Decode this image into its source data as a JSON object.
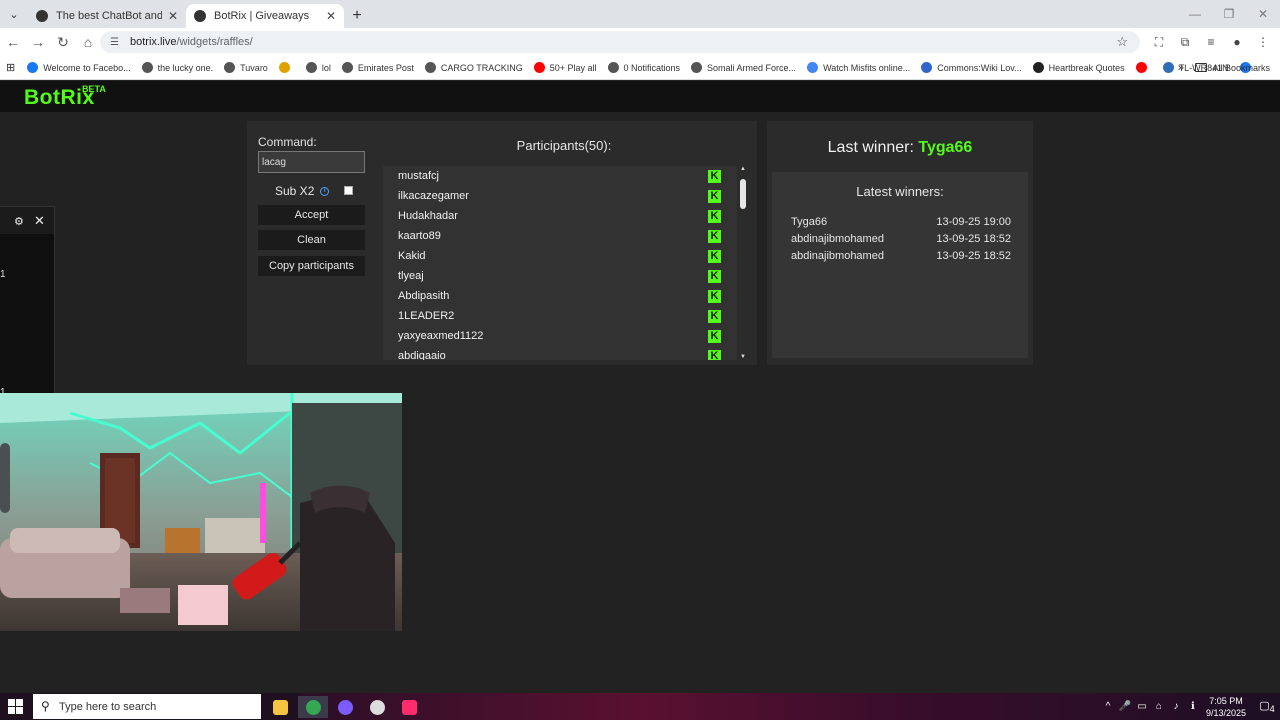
{
  "browser": {
    "tabs": [
      {
        "title": "The best ChatBot and Widgets",
        "close": "✕",
        "active": false
      },
      {
        "title": "BotRix | Giveaways",
        "close": "✕",
        "active": true
      }
    ],
    "new_tab": "+",
    "url_host": "botrix.live",
    "url_path": "/widgets/raffles/",
    "bookmarks": [
      {
        "label": "Welcome to Facebo...",
        "color": "#1877f2"
      },
      {
        "label": "the lucky one.",
        "color": "#555555"
      },
      {
        "label": "Tuvaro",
        "color": "#555555"
      },
      {
        "label": "",
        "color": "#e0a000"
      },
      {
        "label": "lol",
        "color": "#555555"
      },
      {
        "label": "Emirates Post",
        "color": "#555555"
      },
      {
        "label": "CARGO TRACKING",
        "color": "#555555"
      },
      {
        "label": "50+ Play all",
        "color": "#ff0000"
      },
      {
        "label": "0 Notifications",
        "color": "#555555"
      },
      {
        "label": "Somali Armed Force...",
        "color": "#555555"
      },
      {
        "label": "Watch Misfits online...",
        "color": "#4285f4"
      },
      {
        "label": "Commons:Wiki Lov...",
        "color": "#3366cc"
      },
      {
        "label": "Heartbreak Quotes",
        "color": "#222222"
      },
      {
        "label": "",
        "color": "#ff0000"
      },
      {
        "label": "TL-WR841N",
        "color": "#2f6fb5"
      },
      {
        "label": "",
        "color": "#1877f2"
      }
    ],
    "bookmarks_more": "»",
    "all_bookmarks": "All Bookmarks"
  },
  "site": {
    "logo": "BotRix",
    "beta": "BETA"
  },
  "raffle": {
    "command_label": "Command:",
    "command_value": "lacag",
    "sub_x2_label": "Sub X2",
    "info": "i",
    "accept": "Accept",
    "clean": "Clean",
    "copy": "Copy participants",
    "participants_title": "Participants(50):",
    "participants": [
      "mustafcj",
      "ilkacazegamer",
      "Hudakhadar",
      "kaarto89",
      "Kakid",
      "tlyeaj",
      "Abdipasith",
      "1LEADER2",
      "yaxyeaxmed1122",
      "abdiqaaio"
    ],
    "kick_glyph": "K",
    "scroll_up": "▲",
    "scroll_down": "▼"
  },
  "winners": {
    "last_winner_label": "Last winner:",
    "last_winner_name": "Tyga66",
    "latest_title": "Latest winners:",
    "list": [
      {
        "name": "Tyga66",
        "date": "13-09-25 19:00"
      },
      {
        "name": "abdinajibmohamed",
        "date": "13-09-25 18:52"
      },
      {
        "name": "abdinajibmohamed",
        "date": "13-09-25 18:52"
      }
    ]
  },
  "dock": {
    "mark1": "1",
    "mark2": "1"
  },
  "taskbar": {
    "search_placeholder": "Type here to search",
    "time": "7:05 PM",
    "date": "9/13/2025",
    "notifications": "4"
  }
}
